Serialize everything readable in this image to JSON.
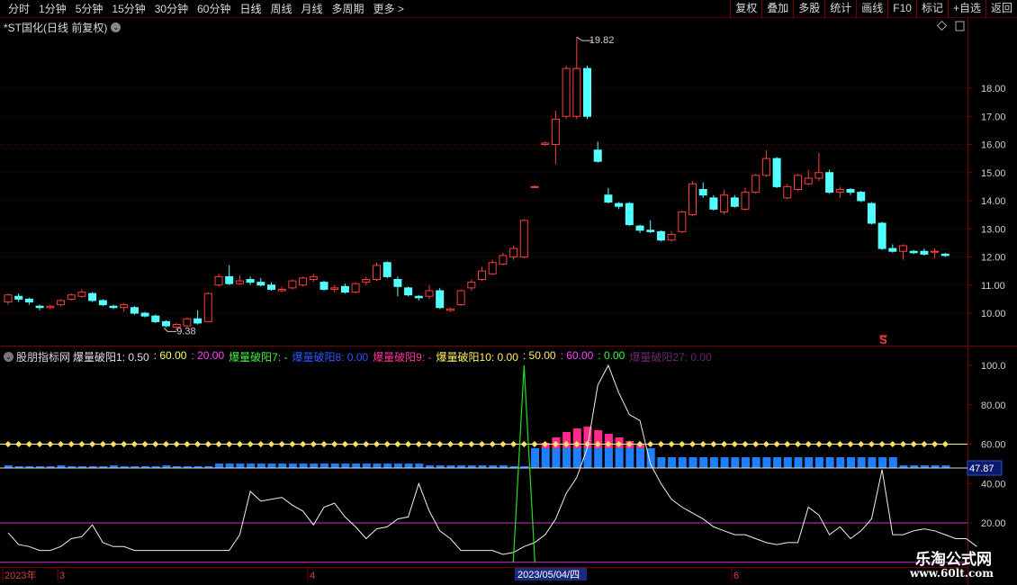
{
  "toolbar": {
    "periods": [
      "分时",
      "1分钟",
      "5分钟",
      "15分钟",
      "30分钟",
      "60分钟",
      "日线",
      "周线",
      "月线",
      "多周期",
      "更多 >"
    ],
    "active_period": "日线",
    "right_buttons": [
      "复权",
      "叠加",
      "多股",
      "统计",
      "画线",
      "F10",
      "标记",
      "+自选",
      "返回"
    ]
  },
  "chart": {
    "title": "*ST国化(日线 前复权)",
    "high_label": "19.82",
    "low_label": "9.38",
    "signal_mark": "S",
    "price_axis": [
      "18.00",
      "17.00",
      "16.00",
      "15.00",
      "14.00",
      "13.00",
      "12.00",
      "11.00",
      "10.00"
    ]
  },
  "indicator": {
    "name": "股朋指标网",
    "legend": [
      {
        "text": "爆量破阳1: 0.50",
        "color": "#e0e0e0"
      },
      {
        "text": ": 60.00",
        "color": "#ffff66"
      },
      {
        "text": ": 20.00",
        "color": "#ff44ff"
      },
      {
        "text": "爆量破阳7: -",
        "color": "#44ee44"
      },
      {
        "text": "爆量破阳8: 0.00",
        "color": "#3355ff"
      },
      {
        "text": "爆量破阳9: -",
        "color": "#ff3399"
      },
      {
        "text": "爆量破阳10: 0.00",
        "color": "#ffee66"
      },
      {
        "text": ": 50.00",
        "color": "#ffee66"
      },
      {
        "text": ": 60.00",
        "color": "#ff44ff"
      },
      {
        "text": ": 0.00",
        "color": "#44ee44"
      },
      {
        "text": "爆量破阳27: 0.00",
        "color": "#6a2a6a"
      }
    ],
    "axis": [
      "100.0",
      "80.00",
      "60.00",
      "40.00",
      "20.00"
    ],
    "current_value": "47.87"
  },
  "time_axis": {
    "labels": [
      "2023年",
      "3",
      "4",
      "6"
    ],
    "cursor_date": "2023/05/04/四"
  },
  "watermark": {
    "cn": "乐淘公式网",
    "url": "www.60lt.com"
  },
  "chart_data": {
    "type": "candlestick",
    "candles": [
      [
        10.4,
        10.65,
        10.3,
        10.7
      ],
      [
        10.6,
        10.5,
        10.4,
        10.7
      ],
      [
        10.5,
        10.4,
        10.3,
        10.55
      ],
      [
        10.25,
        10.2,
        10.1,
        10.3
      ],
      [
        10.2,
        10.25,
        10.15,
        10.3
      ],
      [
        10.3,
        10.45,
        10.25,
        10.5
      ],
      [
        10.5,
        10.65,
        10.45,
        10.7
      ],
      [
        10.6,
        10.75,
        10.55,
        10.85
      ],
      [
        10.7,
        10.45,
        10.4,
        10.75
      ],
      [
        10.45,
        10.3,
        10.25,
        10.5
      ],
      [
        10.25,
        10.2,
        10.15,
        10.3
      ],
      [
        10.2,
        10.3,
        10.05,
        10.35
      ],
      [
        10.2,
        10.0,
        9.95,
        10.25
      ],
      [
        10.0,
        9.9,
        9.85,
        10.05
      ],
      [
        9.9,
        9.7,
        9.65,
        9.95
      ],
      [
        9.7,
        9.55,
        9.5,
        9.75
      ],
      [
        9.5,
        9.6,
        9.38,
        9.65
      ],
      [
        9.55,
        9.8,
        9.5,
        9.85
      ],
      [
        9.8,
        9.65,
        9.6,
        10.1
      ],
      [
        9.7,
        10.7,
        9.7,
        10.75
      ],
      [
        11.0,
        11.3,
        10.95,
        11.4
      ],
      [
        11.3,
        11.05,
        11.0,
        11.7
      ],
      [
        11.05,
        11.15,
        11.0,
        11.35
      ],
      [
        11.2,
        11.1,
        11.0,
        11.3
      ],
      [
        11.1,
        11.0,
        10.95,
        11.25
      ],
      [
        11.0,
        10.85,
        10.8,
        11.1
      ],
      [
        10.8,
        10.85,
        10.75,
        10.95
      ],
      [
        10.9,
        11.15,
        10.85,
        11.2
      ],
      [
        11.0,
        11.25,
        10.95,
        11.3
      ],
      [
        11.2,
        11.3,
        11.1,
        11.4
      ],
      [
        11.1,
        10.85,
        10.8,
        11.15
      ],
      [
        10.85,
        10.9,
        10.75,
        11.0
      ],
      [
        10.95,
        10.75,
        10.7,
        11.05
      ],
      [
        10.75,
        11.05,
        10.7,
        11.1
      ],
      [
        11.1,
        11.2,
        11.0,
        11.3
      ],
      [
        11.2,
        11.7,
        11.15,
        11.8
      ],
      [
        11.8,
        11.3,
        11.25,
        11.85
      ],
      [
        11.2,
        10.95,
        10.6,
        11.3
      ],
      [
        10.9,
        10.65,
        10.6,
        10.95
      ],
      [
        10.6,
        10.55,
        10.45,
        10.65
      ],
      [
        10.6,
        10.8,
        10.5,
        11.0
      ],
      [
        10.8,
        10.2,
        10.15,
        10.9
      ],
      [
        10.1,
        10.15,
        10.05,
        10.2
      ],
      [
        10.3,
        10.8,
        10.25,
        10.85
      ],
      [
        10.9,
        11.1,
        10.8,
        11.2
      ],
      [
        11.2,
        11.5,
        11.15,
        11.65
      ],
      [
        11.4,
        11.8,
        11.35,
        11.9
      ],
      [
        11.75,
        12.05,
        11.7,
        12.15
      ],
      [
        12.0,
        12.3,
        11.9,
        12.4
      ],
      [
        12.0,
        13.3,
        11.95,
        13.35
      ],
      [
        14.5,
        14.5,
        14.45,
        14.55
      ],
      [
        16.0,
        16.05,
        15.95,
        16.1
      ],
      [
        16.0,
        16.9,
        15.3,
        17.2
      ],
      [
        17.0,
        18.7,
        16.9,
        18.8
      ],
      [
        17.0,
        18.7,
        16.9,
        19.82
      ],
      [
        18.7,
        17.0,
        16.9,
        18.8
      ],
      [
        15.8,
        15.4,
        15.35,
        16.1
      ],
      [
        14.2,
        13.95,
        13.9,
        14.45
      ],
      [
        13.9,
        13.8,
        13.7,
        13.95
      ],
      [
        13.9,
        13.15,
        13.1,
        13.95
      ],
      [
        13.1,
        12.95,
        12.85,
        13.15
      ],
      [
        12.95,
        12.9,
        12.85,
        13.3
      ],
      [
        12.9,
        12.6,
        12.55,
        12.95
      ],
      [
        12.6,
        12.8,
        12.55,
        12.9
      ],
      [
        12.9,
        13.6,
        12.85,
        13.65
      ],
      [
        13.5,
        14.6,
        13.45,
        14.7
      ],
      [
        14.4,
        14.2,
        14.1,
        14.65
      ],
      [
        14.1,
        13.7,
        13.65,
        14.2
      ],
      [
        13.6,
        14.2,
        13.5,
        14.4
      ],
      [
        14.1,
        13.8,
        13.75,
        14.2
      ],
      [
        13.7,
        14.3,
        13.65,
        14.45
      ],
      [
        14.3,
        14.9,
        14.25,
        14.95
      ],
      [
        14.9,
        15.5,
        14.85,
        15.8
      ],
      [
        15.5,
        14.5,
        14.45,
        15.55
      ],
      [
        14.1,
        14.5,
        14.05,
        14.6
      ],
      [
        14.4,
        14.9,
        14.35,
        14.95
      ],
      [
        14.6,
        14.8,
        14.55,
        15.1
      ],
      [
        14.8,
        15.0,
        14.7,
        15.7
      ],
      [
        15.0,
        14.3,
        14.25,
        15.1
      ],
      [
        14.3,
        14.4,
        14.1,
        14.5
      ],
      [
        14.4,
        14.3,
        14.2,
        14.45
      ],
      [
        14.3,
        14.0,
        13.95,
        14.35
      ],
      [
        13.9,
        13.2,
        13.15,
        13.95
      ],
      [
        13.2,
        12.3,
        12.25,
        13.25
      ],
      [
        12.3,
        12.2,
        12.15,
        12.45
      ],
      [
        12.2,
        12.4,
        11.9,
        12.45
      ],
      [
        12.2,
        12.15,
        12.1,
        12.25
      ],
      [
        12.2,
        12.1,
        12.05,
        12.3
      ],
      [
        12.2,
        12.2,
        11.95,
        12.3
      ],
      [
        12.1,
        12.05,
        12.0,
        12.15
      ]
    ],
    "indicator_line": [
      15,
      9,
      8,
      6,
      6,
      8,
      12,
      13,
      19,
      10,
      8,
      8,
      6,
      6,
      6,
      6,
      6,
      6,
      6,
      6,
      6,
      6,
      14,
      36,
      31,
      32,
      33,
      29,
      26,
      19,
      28,
      30,
      23,
      18,
      12,
      17,
      18,
      22,
      23,
      40,
      26,
      16,
      12,
      6,
      6,
      6,
      6,
      4,
      5,
      8,
      10,
      14,
      22,
      35,
      43,
      58,
      90,
      100,
      86,
      75,
      72,
      50,
      40,
      32,
      28,
      25,
      22,
      18,
      16,
      14,
      14,
      12,
      10,
      9,
      10,
      10,
      28,
      24,
      14,
      18,
      12,
      16,
      22,
      47,
      14,
      14,
      16,
      17,
      16,
      14,
      12,
      12,
      8
    ]
  }
}
